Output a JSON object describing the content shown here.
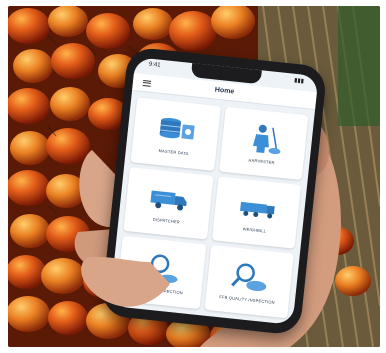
{
  "app": {
    "title": "Home",
    "status_time": "9:41"
  },
  "tiles": [
    {
      "label": "MASTER DATA",
      "icon": "database-icon"
    },
    {
      "label": "HARVESTER",
      "icon": "harvester-icon"
    },
    {
      "label": "DISPATCHER",
      "icon": "truck-icon"
    },
    {
      "label": "WEIGHBILL",
      "icon": "lorry-icon"
    },
    {
      "label": "GRADING INSPECTION",
      "icon": "magnifier-icon"
    },
    {
      "label": "FFB QUALITY INSPECTION",
      "icon": "magnifier-icon"
    }
  ],
  "colors": {
    "accent": "#3a8fd6",
    "tile_bg": "#ffffff",
    "screen_bg": "#eef3f8",
    "fruit_orange": "#e86c22",
    "fruit_dark": "#6a1b08"
  }
}
